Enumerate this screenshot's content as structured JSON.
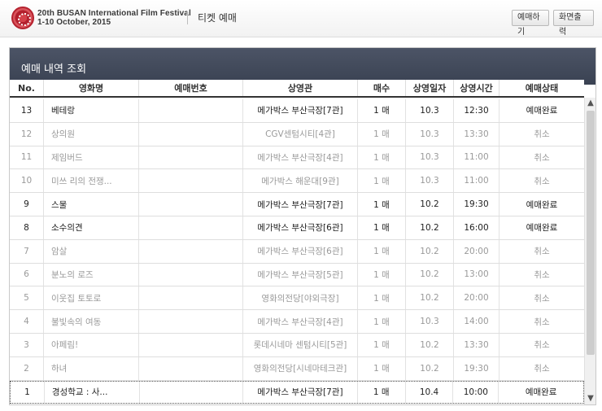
{
  "header": {
    "festival_line1": "20th BUSAN International Film Festival",
    "festival_line2": "1-10 October, 2015",
    "subtitle": "티켓 예매",
    "reserve_button": "예매하기",
    "print_button": "화면출력"
  },
  "panel": {
    "title": "예매 내역 조회"
  },
  "table": {
    "columns": [
      "No.",
      "영화명",
      "예매번호",
      "상영관",
      "매수",
      "상영일자",
      "상영시간",
      "예매상태"
    ],
    "rows": [
      {
        "no": "13",
        "title": "베테랑",
        "code": "",
        "venue": "메가박스 부산극장[7관]",
        "qty": "1 매",
        "date": "10.3",
        "time": "12:30",
        "status": "예매완료",
        "state": "active"
      },
      {
        "no": "12",
        "title": "상의원",
        "code": "",
        "venue": "CGV센텀시티[4관]",
        "qty": "1 매",
        "date": "10.3",
        "time": "13:30",
        "status": "취소",
        "state": "cancel"
      },
      {
        "no": "11",
        "title": "제임버드",
        "code": "",
        "venue": "메가박스 부산극장[4관]",
        "qty": "1 매",
        "date": "10.3",
        "time": "11:00",
        "status": "취소",
        "state": "cancel"
      },
      {
        "no": "10",
        "title": "미쓰 리의 전쟁...",
        "code": "",
        "venue": "메가박스 해운대[9관]",
        "qty": "1 매",
        "date": "10.3",
        "time": "11:00",
        "status": "취소",
        "state": "cancel"
      },
      {
        "no": "9",
        "title": "스물",
        "code": "",
        "venue": "메가박스 부산극장[7관]",
        "qty": "1 매",
        "date": "10.2",
        "time": "19:30",
        "status": "예매완료",
        "state": "active"
      },
      {
        "no": "8",
        "title": "소수의견",
        "code": "",
        "venue": "메가박스 부산극장[6관]",
        "qty": "1 매",
        "date": "10.2",
        "time": "16:00",
        "status": "예매완료",
        "state": "active"
      },
      {
        "no": "7",
        "title": "암살",
        "code": "",
        "venue": "메가박스 부산극장[6관]",
        "qty": "1 매",
        "date": "10.2",
        "time": "20:00",
        "status": "취소",
        "state": "cancel"
      },
      {
        "no": "6",
        "title": "분노의 로즈",
        "code": "",
        "venue": "메가박스 부산극장[5관]",
        "qty": "1 매",
        "date": "10.2",
        "time": "13:00",
        "status": "취소",
        "state": "cancel"
      },
      {
        "no": "5",
        "title": "이웃집 토토로",
        "code": "",
        "venue": "영화의전당[야외극장]",
        "qty": "1 매",
        "date": "10.2",
        "time": "20:00",
        "status": "취소",
        "state": "cancel"
      },
      {
        "no": "4",
        "title": "불빛속의 여동",
        "code": "",
        "venue": "메가박스 부산극장[4관]",
        "qty": "1 매",
        "date": "10.3",
        "time": "14:00",
        "status": "취소",
        "state": "cancel"
      },
      {
        "no": "3",
        "title": "아페림!",
        "code": "",
        "venue": "롯데시네마 센텀시티[5관]",
        "qty": "1 매",
        "date": "10.2",
        "time": "13:30",
        "status": "취소",
        "state": "cancel"
      },
      {
        "no": "2",
        "title": "하녀",
        "code": "",
        "venue": "영화의전당[시네마테크관]",
        "qty": "1 매",
        "date": "10.2",
        "time": "19:30",
        "status": "취소",
        "state": "cancel"
      },
      {
        "no": "1",
        "title": "경성학교 : 사...",
        "code": "",
        "venue": "메가박스 부산극장[7관]",
        "qty": "1 매",
        "date": "10.4",
        "time": "10:00",
        "status": "예매완료",
        "state": "active"
      }
    ]
  },
  "scrollbar": {
    "up_icon": "▲",
    "down_icon": "▼"
  }
}
